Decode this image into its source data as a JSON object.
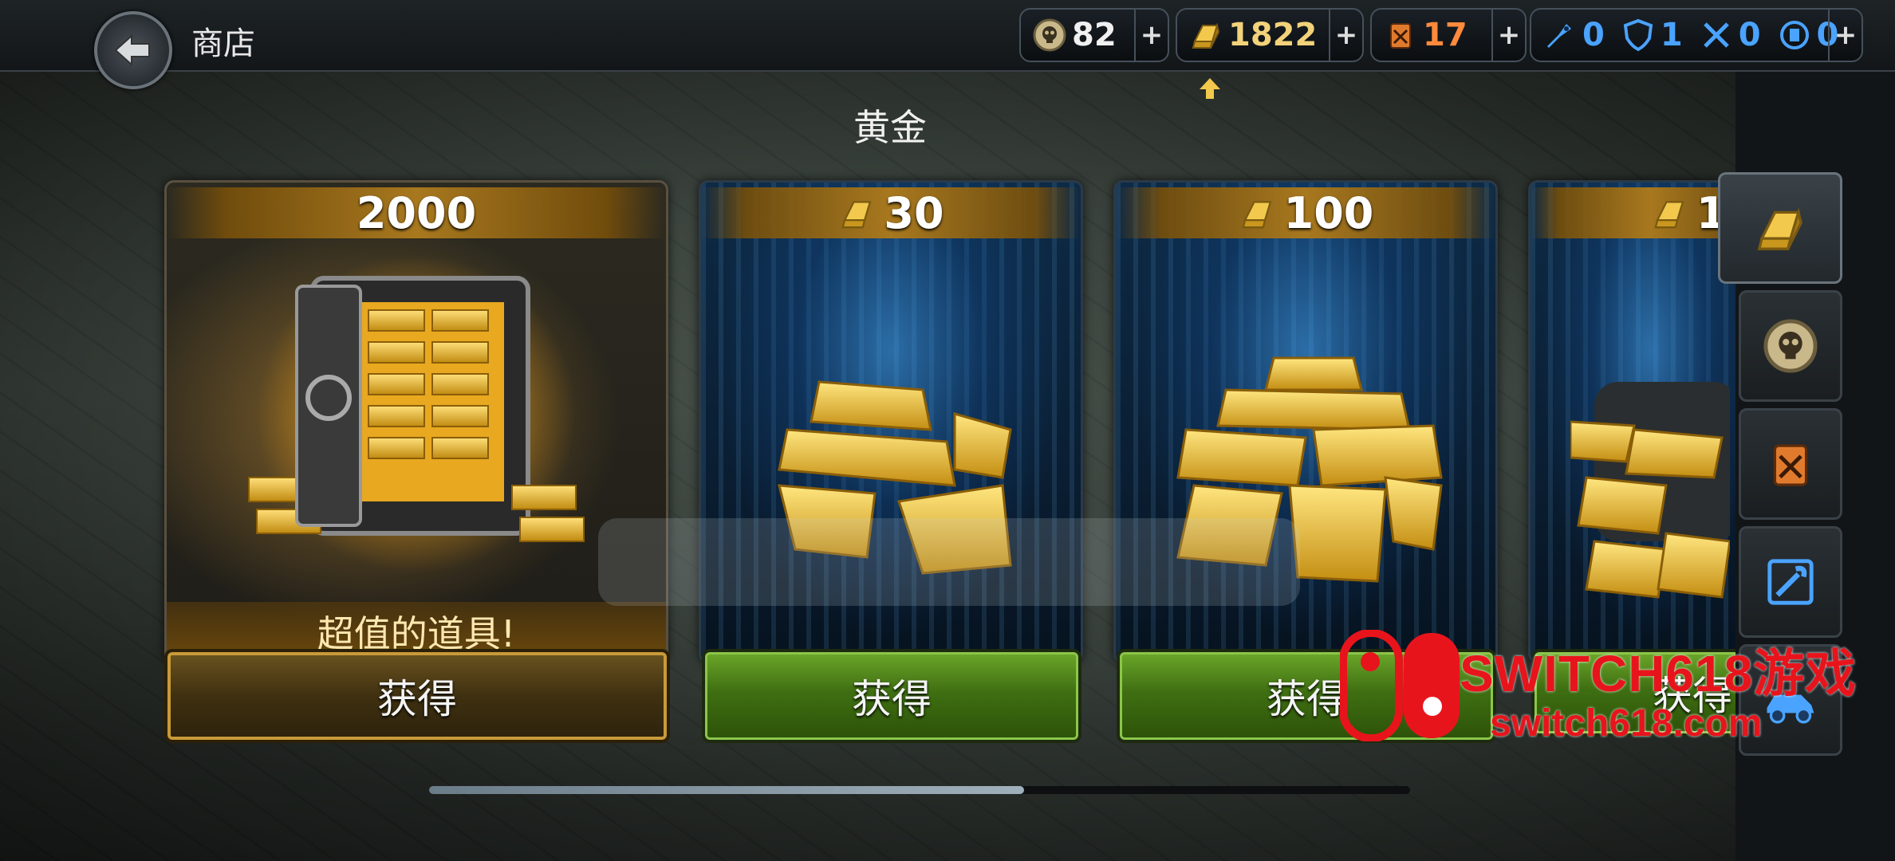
{
  "header": {
    "title": "商店",
    "back_icon": "back-arrow-icon"
  },
  "resources": [
    {
      "icon": "skull-coin-icon",
      "value": "82",
      "plus": "+"
    },
    {
      "icon": "gold-bar-icon",
      "value": "1822",
      "plus": "+"
    },
    {
      "icon": "fuel-can-icon",
      "value": "17",
      "plus": "+",
      "color": "#ff8a3c"
    },
    {
      "icons": [
        "rocket-icon",
        "shield-icon",
        "tools-icon",
        "fuel-icon"
      ],
      "values": [
        "0",
        "1",
        "0",
        "0"
      ],
      "plus": "+",
      "color": "#4aa3ff"
    }
  ],
  "section_title": "黄金",
  "cards": [
    {
      "price": "2000",
      "bonus_text": "超值的道具!",
      "button_label": "获得",
      "style": "gold"
    },
    {
      "price": "30",
      "button_label": "获得",
      "style": "blue"
    },
    {
      "price": "100",
      "button_label": "获得",
      "style": "blue"
    },
    {
      "price": "1",
      "button_label": "获得",
      "style": "blue"
    }
  ],
  "scroll": {
    "position_fraction": 0.61
  },
  "sidebar_tabs": [
    {
      "icon": "gold-bar-icon",
      "active": true
    },
    {
      "icon": "skull-coin-icon",
      "active": false
    },
    {
      "icon": "fuel-can-icon",
      "active": false
    },
    {
      "icon": "wrench-icon",
      "active": false
    },
    {
      "icon": "vehicle-icon",
      "active": false
    }
  ],
  "watermark": {
    "line1": "SWITCH618游戏",
    "line2": "switch618.com"
  },
  "colors": {
    "gold": "#e0b030",
    "green_button": "#5d9a22",
    "accent_blue": "#4aa3ff",
    "orange": "#ff8a3c"
  }
}
